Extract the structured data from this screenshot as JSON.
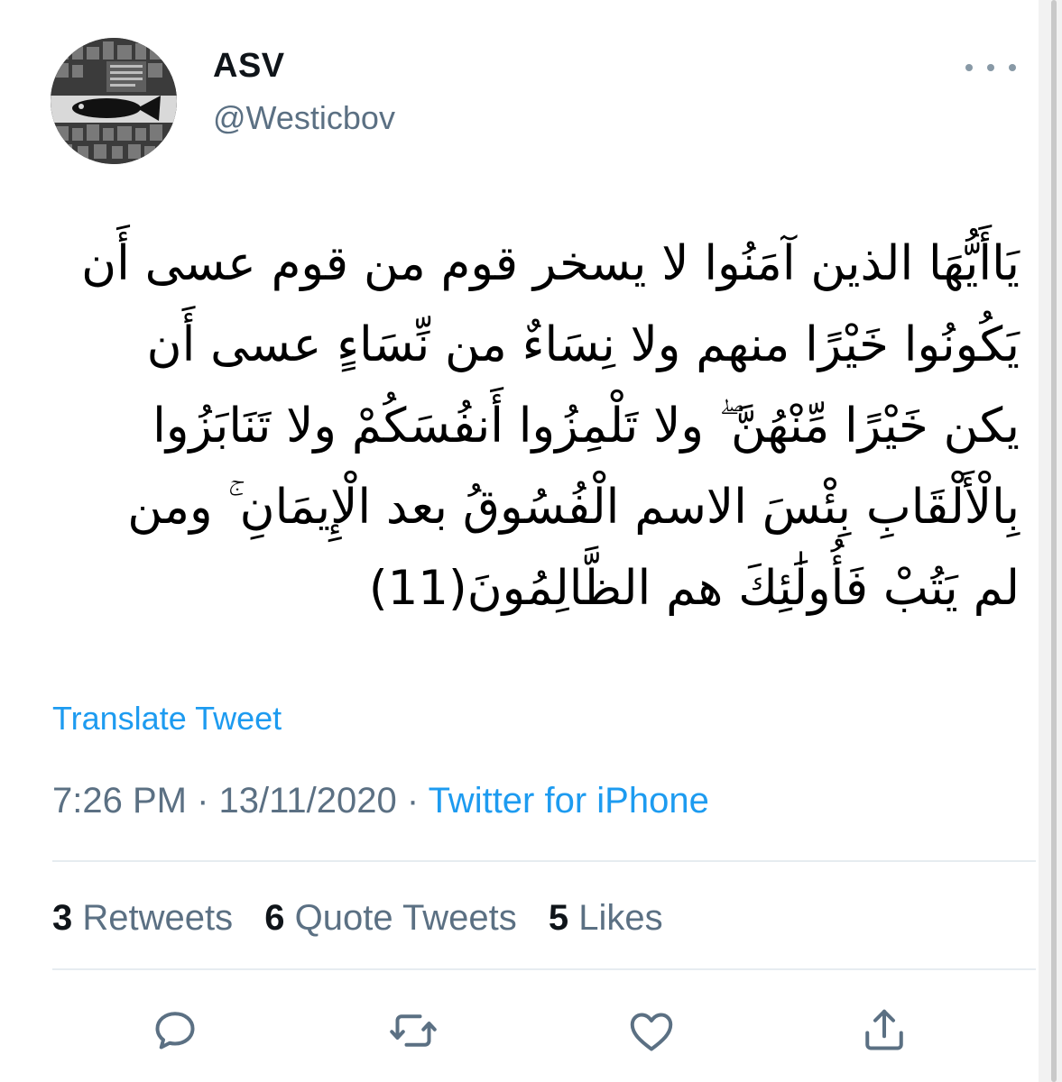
{
  "user": {
    "display_name": "ASV",
    "handle": "@Westicbov"
  },
  "tweet": {
    "lines": [
      "يَاأَيُّهَا الذين آمَنُوا لا يسخر قوم من قوم عسى أَن",
      "يَكُونُوا خَيْرًا منهم ولا نِسَاءٌ من نِّسَاءٍ عسى أَن",
      "يكن خَيْرًا مِّنْهُنَّ ۖ ولا تَلْمِزُوا أَنفُسَكُمْ ولا تَنَابَزُوا",
      "بِالْأَلْقَابِ  بِئْسَ الاسم الْفُسُوقُ بعد الْإِيمَانِ ۚ ومن",
      "لم يَتُبْ فَأُولَٰئِكَ هم الظَّالِمُونَ(11)"
    ]
  },
  "translate_label": "Translate Tweet",
  "meta": {
    "time": "7:26 PM",
    "separator": " · ",
    "date": "13/11/2020",
    "source": "Twitter for iPhone"
  },
  "stats": {
    "retweets": {
      "count": "3",
      "label": "Retweets"
    },
    "quotes": {
      "count": "6",
      "label": "Quote Tweets"
    },
    "likes": {
      "count": "5",
      "label": "Likes"
    }
  },
  "actions": [
    "reply-icon",
    "retweet-icon",
    "like-icon",
    "share-icon"
  ],
  "colors": {
    "link": "#1d9bf0",
    "secondary": "#5b7083",
    "divider": "#e6ecf0"
  }
}
